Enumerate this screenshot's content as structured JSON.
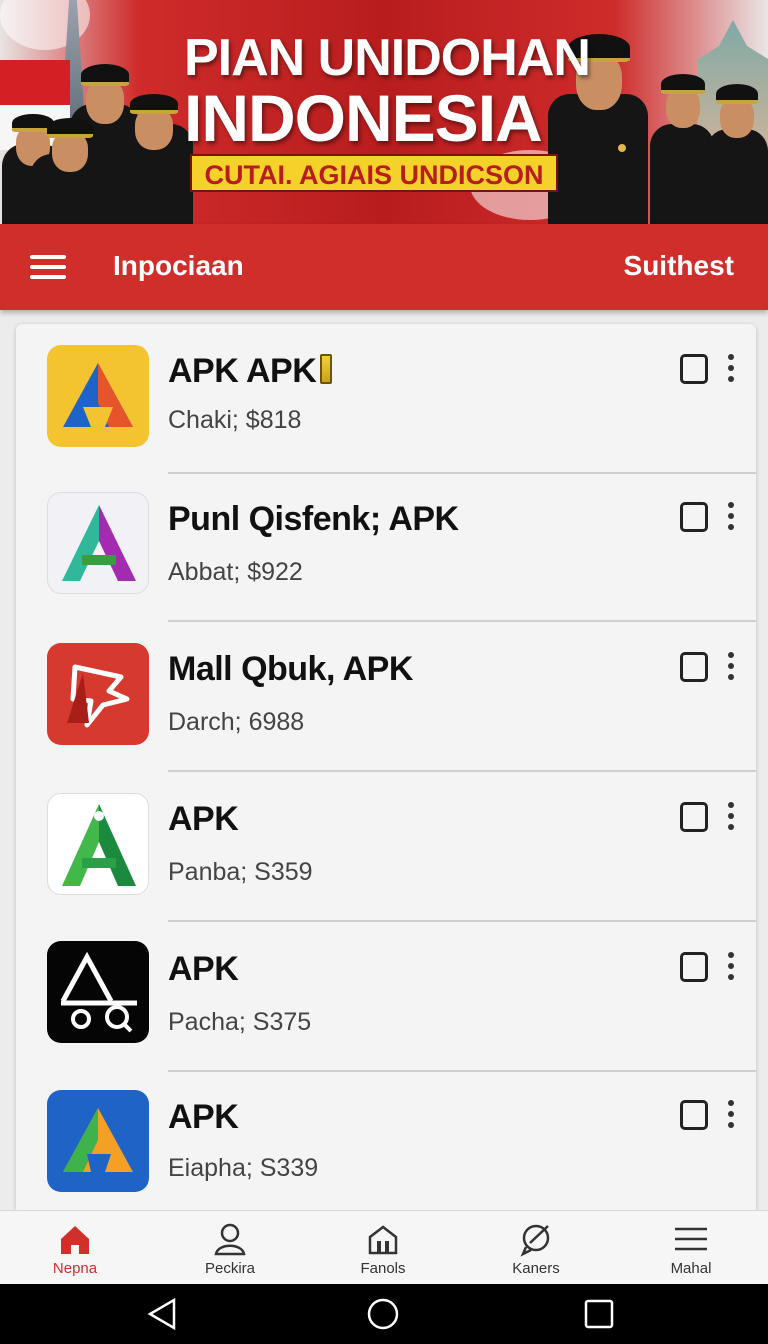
{
  "banner": {
    "title_line1": "PIAN UNIDOHAN",
    "title_line2": "INDONESIA",
    "subtitle": "CUTAI. AGIAIS UNDICSON"
  },
  "appbar": {
    "title": "Inpociaan",
    "action": "Suithest"
  },
  "apps": [
    {
      "name": "APK APK",
      "price": "Chaki; $818",
      "icon": "orange-blue-a-logo-icon",
      "has_battery_icon": true
    },
    {
      "name": "Punl Qisfenk; APK",
      "price": "Abbat; $922",
      "icon": "purple-green-a-logo-icon"
    },
    {
      "name": "Mall Qbuk, APK",
      "price": "Darch; 6988",
      "icon": "red-bird-logo-icon"
    },
    {
      "name": "APK",
      "price": "Panba; S359",
      "icon": "green-a-logo-icon"
    },
    {
      "name": "APK",
      "price": "Pacha; S375",
      "icon": "black-aq-logo-icon"
    },
    {
      "name": "APK",
      "price": "Eiapha; S339",
      "icon": "blue-a-logo-icon"
    }
  ],
  "bottom_nav": [
    {
      "label": "Nepna",
      "icon": "home-icon",
      "active": true
    },
    {
      "label": "Peckira",
      "icon": "person-icon"
    },
    {
      "label": "Fanols",
      "icon": "store-icon"
    },
    {
      "label": "Kaners",
      "icon": "chat-icon"
    },
    {
      "label": "Mahal",
      "icon": "list-icon"
    }
  ],
  "system_nav": [
    "back-icon",
    "home-circle-icon",
    "recents-icon"
  ],
  "colors": {
    "brand_red": "#cf2e2b",
    "active_nav": "#d0302a",
    "banner_yellow": "#f4d22a"
  }
}
